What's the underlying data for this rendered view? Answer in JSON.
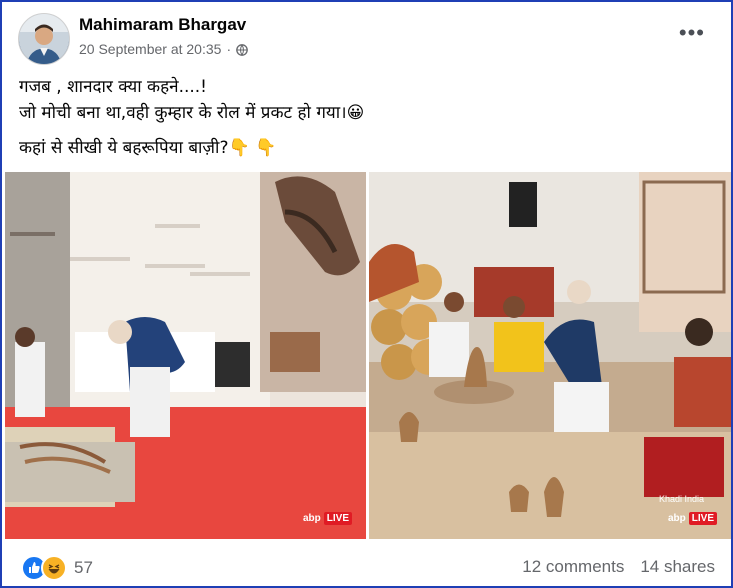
{
  "post": {
    "author": "Mahimaram Bhargav",
    "timestamp": "20 September at 20:35",
    "dot": "·",
    "menu_icon": "more-horizontal-icon",
    "privacy_icon": "globe-icon",
    "lines": [
      "गजब , शानदार क्या कहने....!",
      "जो मोची बना था,वही कुम्हार के रोल में प्रकट हो गया।😀",
      "कहां से सीखी ये बहरूपिया बाज़ी?👇           👇"
    ]
  },
  "photos": {
    "left_badge": "abp",
    "left_live": "LIVE",
    "right_khadi_sign": "Khadi India",
    "right_badge": "abp",
    "right_live": "LIVE"
  },
  "footer": {
    "reaction_icons": [
      "like-icon",
      "haha-icon"
    ],
    "reaction_count": "57",
    "comments": "12 comments",
    "shares": "14 shares"
  }
}
